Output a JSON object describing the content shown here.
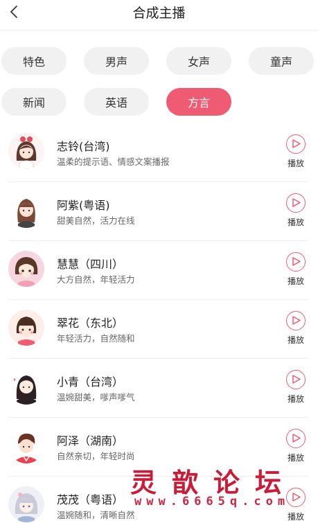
{
  "header": {
    "title": "合成主播"
  },
  "filters": [
    {
      "label": "特色",
      "active": false
    },
    {
      "label": "男声",
      "active": false
    },
    {
      "label": "女声",
      "active": false
    },
    {
      "label": "童声",
      "active": false
    },
    {
      "label": "新闻",
      "active": false
    },
    {
      "label": "英语",
      "active": false
    },
    {
      "label": "方言",
      "active": true
    }
  ],
  "anchors": [
    {
      "name": "志铃(台湾)",
      "desc": "温柔的提示语、情感文案播报",
      "play_label": "播放"
    },
    {
      "name": "阿紫(粤语)",
      "desc": "甜美自然，活力在线",
      "play_label": "播放"
    },
    {
      "name": "慧慧（四川）",
      "desc": "大方自然，年轻活力",
      "play_label": "播放"
    },
    {
      "name": "翠花（东北）",
      "desc": "年轻活力，自然随和",
      "play_label": "播放"
    },
    {
      "name": "小青（台湾）",
      "desc": "温婉甜美，嗲声嗲气",
      "play_label": "播放"
    },
    {
      "name": "阿泽（湖南）",
      "desc": "自然亲切，年轻时尚",
      "play_label": "播放"
    },
    {
      "name": "茂茂（粤语）",
      "desc": "温婉随和，清晰自然",
      "play_label": "播放"
    }
  ],
  "watermark": {
    "title": "灵歆论坛",
    "url": "www.6665q.com"
  },
  "colors": {
    "accent": "#ef5b72",
    "watermark": "#c8102e"
  }
}
